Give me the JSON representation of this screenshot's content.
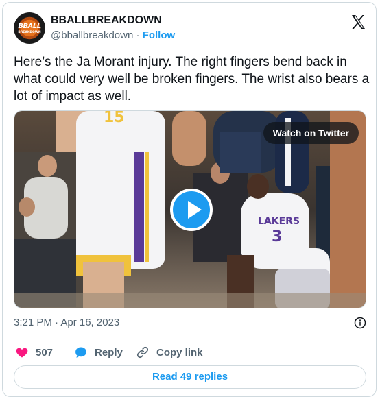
{
  "account": {
    "name": "BBALLBREAKDOWN",
    "handle": "@bballbreakdown",
    "separator": "·",
    "follow_label": "Follow",
    "avatar_text": "BBALL",
    "avatar_subtext": "BREAKDOWN"
  },
  "tweet": {
    "text": "Here’s the Ja Morant injury. The right fingers bend back in what could very well be broken fingers. The wrist also bears a lot of impact as well.",
    "timestamp": "3:21 PM · Apr 16, 2023"
  },
  "media": {
    "watch_label": "Watch on Twitter",
    "jersey_number_left": "15",
    "jersey_number_right": "3",
    "jersey_team": "LAKERS"
  },
  "actions": {
    "likes": "507",
    "reply_label": "Reply",
    "copy_label": "Copy link"
  },
  "read_replies_label": "Read 49 replies",
  "colors": {
    "accent": "#1d9bf0",
    "like": "#f91880",
    "text": "#0f1419",
    "muted": "#536471"
  }
}
